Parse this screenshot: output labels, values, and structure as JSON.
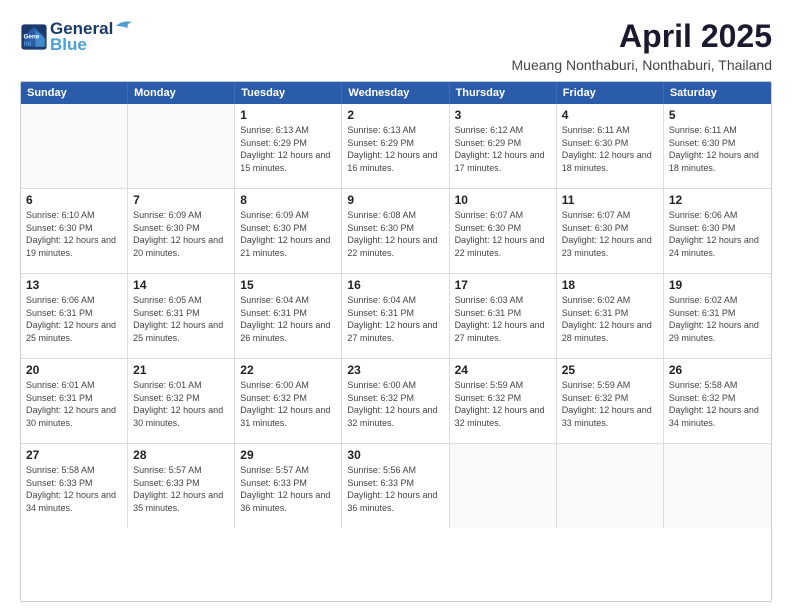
{
  "header": {
    "logo_line1": "General",
    "logo_line2": "Blue",
    "month": "April 2025",
    "location": "Mueang Nonthaburi, Nonthaburi, Thailand"
  },
  "days_of_week": [
    "Sunday",
    "Monday",
    "Tuesday",
    "Wednesday",
    "Thursday",
    "Friday",
    "Saturday"
  ],
  "weeks": [
    [
      {
        "day": "",
        "empty": true
      },
      {
        "day": "",
        "empty": true
      },
      {
        "day": "1",
        "sunrise": "6:13 AM",
        "sunset": "6:29 PM",
        "daylight": "12 hours and 15 minutes."
      },
      {
        "day": "2",
        "sunrise": "6:13 AM",
        "sunset": "6:29 PM",
        "daylight": "12 hours and 16 minutes."
      },
      {
        "day": "3",
        "sunrise": "6:12 AM",
        "sunset": "6:29 PM",
        "daylight": "12 hours and 17 minutes."
      },
      {
        "day": "4",
        "sunrise": "6:11 AM",
        "sunset": "6:30 PM",
        "daylight": "12 hours and 18 minutes."
      },
      {
        "day": "5",
        "sunrise": "6:11 AM",
        "sunset": "6:30 PM",
        "daylight": "12 hours and 18 minutes."
      }
    ],
    [
      {
        "day": "6",
        "sunrise": "6:10 AM",
        "sunset": "6:30 PM",
        "daylight": "12 hours and 19 minutes."
      },
      {
        "day": "7",
        "sunrise": "6:09 AM",
        "sunset": "6:30 PM",
        "daylight": "12 hours and 20 minutes."
      },
      {
        "day": "8",
        "sunrise": "6:09 AM",
        "sunset": "6:30 PM",
        "daylight": "12 hours and 21 minutes."
      },
      {
        "day": "9",
        "sunrise": "6:08 AM",
        "sunset": "6:30 PM",
        "daylight": "12 hours and 22 minutes."
      },
      {
        "day": "10",
        "sunrise": "6:07 AM",
        "sunset": "6:30 PM",
        "daylight": "12 hours and 22 minutes."
      },
      {
        "day": "11",
        "sunrise": "6:07 AM",
        "sunset": "6:30 PM",
        "daylight": "12 hours and 23 minutes."
      },
      {
        "day": "12",
        "sunrise": "6:06 AM",
        "sunset": "6:30 PM",
        "daylight": "12 hours and 24 minutes."
      }
    ],
    [
      {
        "day": "13",
        "sunrise": "6:06 AM",
        "sunset": "6:31 PM",
        "daylight": "12 hours and 25 minutes."
      },
      {
        "day": "14",
        "sunrise": "6:05 AM",
        "sunset": "6:31 PM",
        "daylight": "12 hours and 25 minutes."
      },
      {
        "day": "15",
        "sunrise": "6:04 AM",
        "sunset": "6:31 PM",
        "daylight": "12 hours and 26 minutes."
      },
      {
        "day": "16",
        "sunrise": "6:04 AM",
        "sunset": "6:31 PM",
        "daylight": "12 hours and 27 minutes."
      },
      {
        "day": "17",
        "sunrise": "6:03 AM",
        "sunset": "6:31 PM",
        "daylight": "12 hours and 27 minutes."
      },
      {
        "day": "18",
        "sunrise": "6:02 AM",
        "sunset": "6:31 PM",
        "daylight": "12 hours and 28 minutes."
      },
      {
        "day": "19",
        "sunrise": "6:02 AM",
        "sunset": "6:31 PM",
        "daylight": "12 hours and 29 minutes."
      }
    ],
    [
      {
        "day": "20",
        "sunrise": "6:01 AM",
        "sunset": "6:31 PM",
        "daylight": "12 hours and 30 minutes."
      },
      {
        "day": "21",
        "sunrise": "6:01 AM",
        "sunset": "6:32 PM",
        "daylight": "12 hours and 30 minutes."
      },
      {
        "day": "22",
        "sunrise": "6:00 AM",
        "sunset": "6:32 PM",
        "daylight": "12 hours and 31 minutes."
      },
      {
        "day": "23",
        "sunrise": "6:00 AM",
        "sunset": "6:32 PM",
        "daylight": "12 hours and 32 minutes."
      },
      {
        "day": "24",
        "sunrise": "5:59 AM",
        "sunset": "6:32 PM",
        "daylight": "12 hours and 32 minutes."
      },
      {
        "day": "25",
        "sunrise": "5:59 AM",
        "sunset": "6:32 PM",
        "daylight": "12 hours and 33 minutes."
      },
      {
        "day": "26",
        "sunrise": "5:58 AM",
        "sunset": "6:32 PM",
        "daylight": "12 hours and 34 minutes."
      }
    ],
    [
      {
        "day": "27",
        "sunrise": "5:58 AM",
        "sunset": "6:33 PM",
        "daylight": "12 hours and 34 minutes."
      },
      {
        "day": "28",
        "sunrise": "5:57 AM",
        "sunset": "6:33 PM",
        "daylight": "12 hours and 35 minutes."
      },
      {
        "day": "29",
        "sunrise": "5:57 AM",
        "sunset": "6:33 PM",
        "daylight": "12 hours and 36 minutes."
      },
      {
        "day": "30",
        "sunrise": "5:56 AM",
        "sunset": "6:33 PM",
        "daylight": "12 hours and 36 minutes."
      },
      {
        "day": "",
        "empty": true
      },
      {
        "day": "",
        "empty": true
      },
      {
        "day": "",
        "empty": true
      }
    ]
  ],
  "labels": {
    "sunrise_prefix": "Sunrise: ",
    "sunset_prefix": "Sunset: ",
    "daylight_prefix": "Daylight: "
  }
}
